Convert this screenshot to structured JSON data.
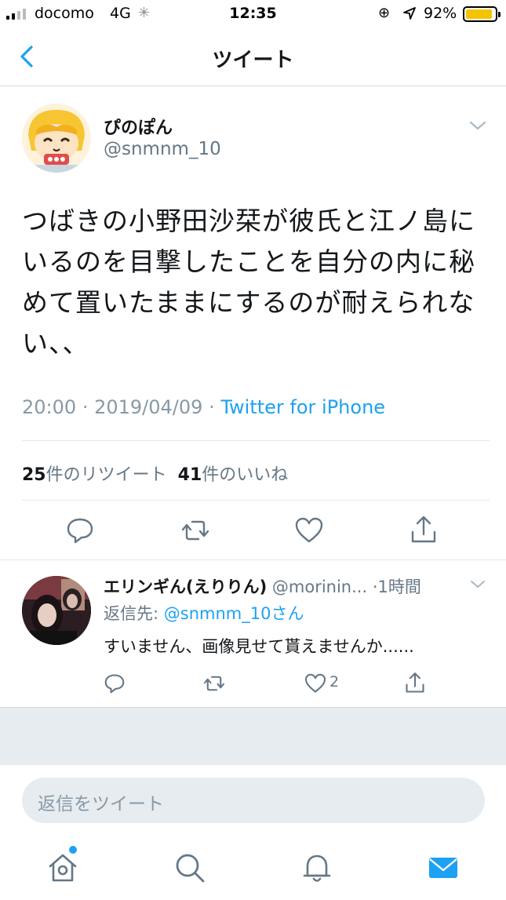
{
  "status_bar": {
    "carrier": "docomo",
    "network": "4G",
    "time": "12:35",
    "battery_percent": "92%",
    "battery_level": 0.92
  },
  "header": {
    "title": "ツイート"
  },
  "tweet": {
    "display_name": "ぴのぽん",
    "handle": "@snmnm_10",
    "text": "つばきの小野田沙栞が彼氏と江ノ島にいるのを目撃したことを自分の内に秘めて置いたままにするのが耐えられない、、",
    "time": "20:00",
    "date": "2019/04/09",
    "separator": "·",
    "source": "Twitter for iPhone",
    "retweet_count": "25",
    "retweet_label": "件のリツイート",
    "like_count": "41",
    "like_label": "件のいいね"
  },
  "reply": {
    "display_name": "エリンギん(えりりん)",
    "handle": "@morinin...",
    "time_ago": "·1時間",
    "reply_to_label": "返信先:",
    "reply_to_mention": "@snmnm_10さん",
    "text": "すいません、画像見せて貰えませんか......",
    "like_count": "2"
  },
  "composer": {
    "placeholder": "返信をツイート"
  },
  "colors": {
    "accent": "#1da1f2",
    "secondary_text": "#657786",
    "meta_text": "#8899a6",
    "divider": "#e1e8ed",
    "battery": "#f5c400"
  },
  "icons": {
    "back": "chevron-left-icon",
    "reply": "speech-bubble-icon",
    "retweet": "retweet-arrows-icon",
    "like": "heart-icon",
    "share": "share-upload-icon",
    "home": "home-icon",
    "search": "search-icon",
    "notifications": "bell-icon",
    "messages": "envelope-icon"
  }
}
